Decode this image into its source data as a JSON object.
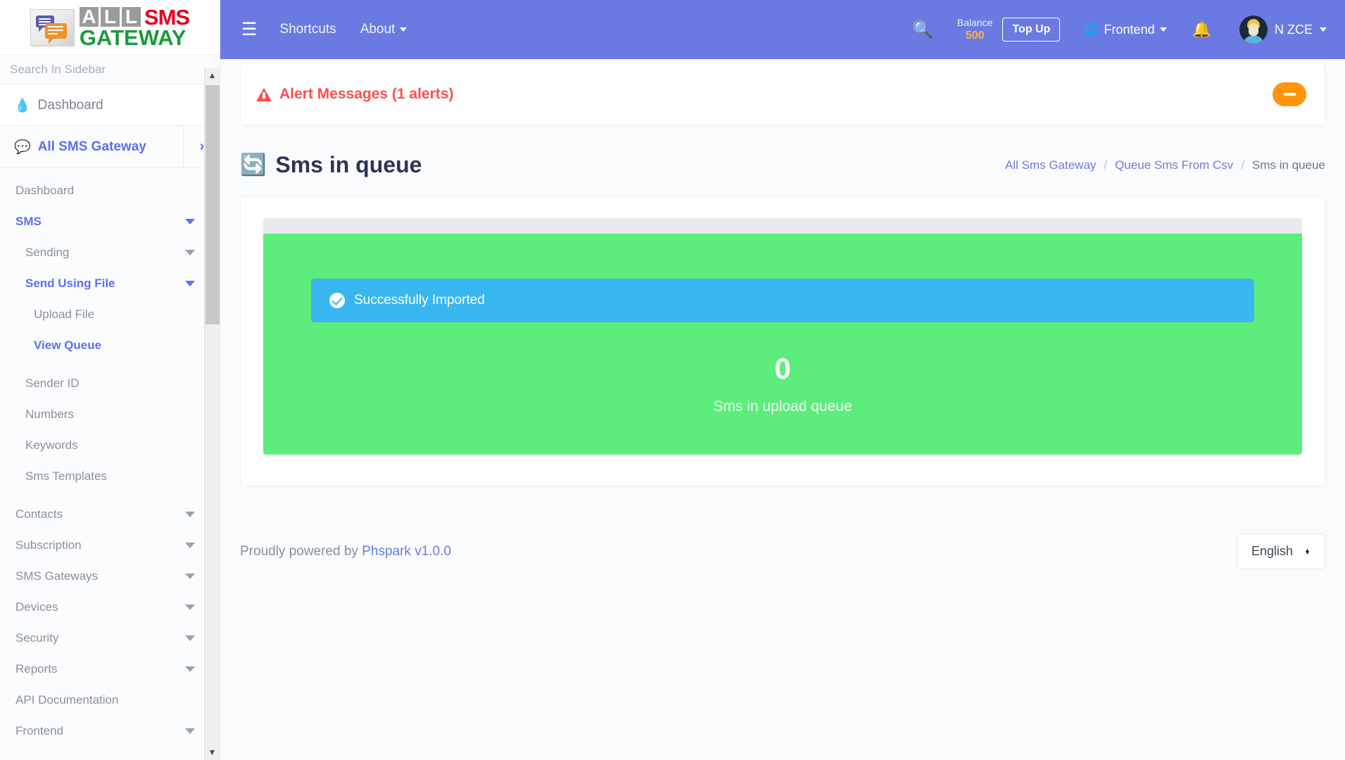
{
  "brand": {
    "logo_all": [
      "A",
      "L",
      "L"
    ],
    "logo_sms": "SMS",
    "logo_gateway": "GATEWAY",
    "colors": {
      "sms_red": "#e4001b",
      "gateway_green": "#1a9b3c",
      "box_gray": "#9b9b9b"
    }
  },
  "sidebar": {
    "search_placeholder": "Search In Sidebar",
    "dashboard_label": "Dashboard",
    "group": {
      "label": "All SMS Gateway",
      "toggle_icon": "chevron-right-icon"
    },
    "items": [
      {
        "label": "Dashboard",
        "level": 1,
        "caret": false,
        "active": false
      },
      {
        "label": "SMS",
        "level": 1,
        "caret": true,
        "active": true
      },
      {
        "label": "Sending",
        "level": 2,
        "caret": true,
        "active": false
      },
      {
        "label": "Send Using File",
        "level": 2,
        "caret": true,
        "active": true
      },
      {
        "label": "Upload File",
        "level": 3,
        "caret": false,
        "active": false
      },
      {
        "label": "View Queue",
        "level": 3,
        "caret": false,
        "active": true
      },
      {
        "label": "Sender ID",
        "level": 2,
        "caret": false,
        "active": false
      },
      {
        "label": "Numbers",
        "level": 2,
        "caret": false,
        "active": false
      },
      {
        "label": "Keywords",
        "level": 2,
        "caret": false,
        "active": false
      },
      {
        "label": "Sms Templates",
        "level": 2,
        "caret": false,
        "active": false
      },
      {
        "label": "Contacts",
        "level": 1,
        "caret": true,
        "active": false
      },
      {
        "label": "Subscription",
        "level": 1,
        "caret": true,
        "active": false
      },
      {
        "label": "SMS Gateways",
        "level": 1,
        "caret": true,
        "active": false
      },
      {
        "label": "Devices",
        "level": 1,
        "caret": true,
        "active": false
      },
      {
        "label": "Security",
        "level": 1,
        "caret": true,
        "active": false
      },
      {
        "label": "Reports",
        "level": 1,
        "caret": true,
        "active": false
      },
      {
        "label": "API Documentation",
        "level": 1,
        "caret": false,
        "active": false
      },
      {
        "label": "Frontend",
        "level": 1,
        "caret": true,
        "active": false
      }
    ]
  },
  "navbar": {
    "burger_icon": "hamburger-icon",
    "shortcuts_label": "Shortcuts",
    "about_label": "About",
    "search_icon": "search-icon",
    "balance_label": "Balance",
    "balance_value": "500",
    "topup_label": "Top Up",
    "frontend_label": "Frontend",
    "globe_icon": "globe-icon",
    "bell_icon": "bell-icon",
    "user_name": "N ZCE",
    "bg_color": "#6b7ae2",
    "balance_color": "#ffb43a"
  },
  "alert": {
    "text": "Alert Messages (1 alerts)",
    "icon": "warning-triangle-icon",
    "color": "#fb4f4f",
    "collapse_icon": "minus-icon",
    "collapse_color": "#ff950d"
  },
  "page": {
    "title": "Sms in queue",
    "title_icon": "sync-icon",
    "breadcrumbs": [
      {
        "label": "All Sms Gateway",
        "link": true
      },
      {
        "label": "Queue Sms From Csv",
        "link": true
      },
      {
        "label": "Sms in queue",
        "link": false
      }
    ],
    "breadcrumb_separator": "/"
  },
  "queue_card": {
    "success_text": "Successfully Imported",
    "success_icon": "check-circle-icon",
    "count": "0",
    "count_label": "Sms in upload queue",
    "green": "#5ced7d",
    "blue": "#38b6f0"
  },
  "footer": {
    "powered_prefix": "Proudly powered by",
    "powered_link": "Phspark v1.0.0",
    "language": "English"
  }
}
